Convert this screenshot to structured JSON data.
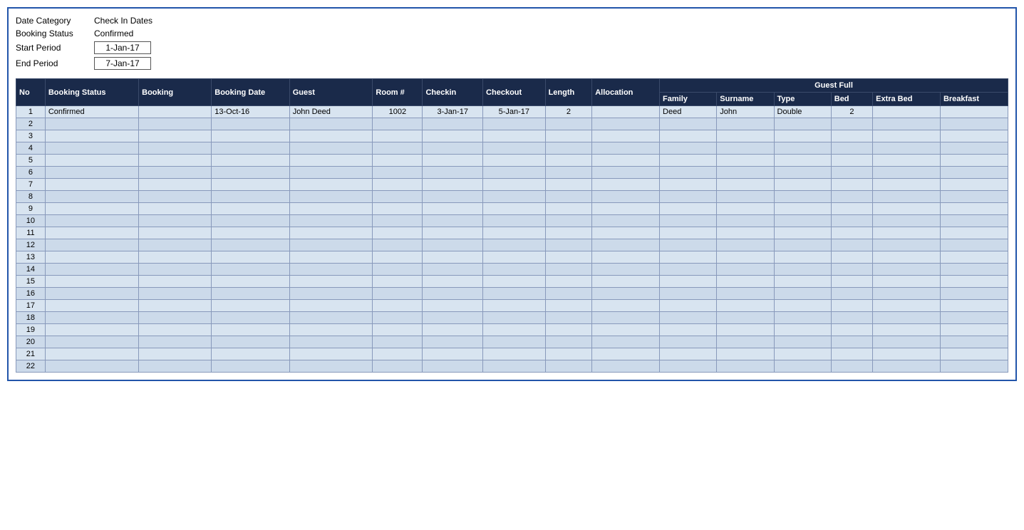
{
  "filters": {
    "date_category_label": "Date Category",
    "date_category_value": "Check In Dates",
    "booking_status_label": "Booking Status",
    "booking_status_value": "Confirmed",
    "start_period_label": "Start Period",
    "start_period_value": "1-Jan-17",
    "end_period_label": "End Period",
    "end_period_value": "7-Jan-17"
  },
  "table": {
    "headers": {
      "no": "No",
      "booking_status": "Booking Status",
      "booking": "Booking",
      "booking_date": "Booking Date",
      "guest": "Guest",
      "room": "Room #",
      "checkin": "Checkin",
      "checkout": "Checkout",
      "length": "Length",
      "allocation": "Allocation",
      "guest_full": "Guest Full",
      "family": "Family",
      "surname": "Surname",
      "type": "Type",
      "bed": "Bed",
      "extra_bed": "Extra Bed",
      "breakfast": "Breakfast"
    },
    "rows": [
      {
        "no": 1,
        "booking_status": "Confirmed",
        "booking": "",
        "booking_date": "13-Oct-16",
        "guest": "John Deed",
        "room": "1002",
        "checkin": "3-Jan-17",
        "checkout": "5-Jan-17",
        "length": "2",
        "allocation": "",
        "family": "Deed",
        "surname": "John",
        "type": "Double",
        "bed": "2",
        "extra_bed": "",
        "breakfast": ""
      },
      {
        "no": 2,
        "booking_status": "",
        "booking": "",
        "booking_date": "",
        "guest": "",
        "room": "",
        "checkin": "",
        "checkout": "",
        "length": "",
        "allocation": "",
        "family": "",
        "surname": "",
        "type": "",
        "bed": "",
        "extra_bed": "",
        "breakfast": ""
      },
      {
        "no": 3,
        "booking_status": "",
        "booking": "",
        "booking_date": "",
        "guest": "",
        "room": "",
        "checkin": "",
        "checkout": "",
        "length": "",
        "allocation": "",
        "family": "",
        "surname": "",
        "type": "",
        "bed": "",
        "extra_bed": "",
        "breakfast": ""
      },
      {
        "no": 4,
        "booking_status": "",
        "booking": "",
        "booking_date": "",
        "guest": "",
        "room": "",
        "checkin": "",
        "checkout": "",
        "length": "",
        "allocation": "",
        "family": "",
        "surname": "",
        "type": "",
        "bed": "",
        "extra_bed": "",
        "breakfast": ""
      },
      {
        "no": 5,
        "booking_status": "",
        "booking": "",
        "booking_date": "",
        "guest": "",
        "room": "",
        "checkin": "",
        "checkout": "",
        "length": "",
        "allocation": "",
        "family": "",
        "surname": "",
        "type": "",
        "bed": "",
        "extra_bed": "",
        "breakfast": ""
      },
      {
        "no": 6,
        "booking_status": "",
        "booking": "",
        "booking_date": "",
        "guest": "",
        "room": "",
        "checkin": "",
        "checkout": "",
        "length": "",
        "allocation": "",
        "family": "",
        "surname": "",
        "type": "",
        "bed": "",
        "extra_bed": "",
        "breakfast": ""
      },
      {
        "no": 7,
        "booking_status": "",
        "booking": "",
        "booking_date": "",
        "guest": "",
        "room": "",
        "checkin": "",
        "checkout": "",
        "length": "",
        "allocation": "",
        "family": "",
        "surname": "",
        "type": "",
        "bed": "",
        "extra_bed": "",
        "breakfast": ""
      },
      {
        "no": 8,
        "booking_status": "",
        "booking": "",
        "booking_date": "",
        "guest": "",
        "room": "",
        "checkin": "",
        "checkout": "",
        "length": "",
        "allocation": "",
        "family": "",
        "surname": "",
        "type": "",
        "bed": "",
        "extra_bed": "",
        "breakfast": ""
      },
      {
        "no": 9,
        "booking_status": "",
        "booking": "",
        "booking_date": "",
        "guest": "",
        "room": "",
        "checkin": "",
        "checkout": "",
        "length": "",
        "allocation": "",
        "family": "",
        "surname": "",
        "type": "",
        "bed": "",
        "extra_bed": "",
        "breakfast": ""
      },
      {
        "no": 10,
        "booking_status": "",
        "booking": "",
        "booking_date": "",
        "guest": "",
        "room": "",
        "checkin": "",
        "checkout": "",
        "length": "",
        "allocation": "",
        "family": "",
        "surname": "",
        "type": "",
        "bed": "",
        "extra_bed": "",
        "breakfast": ""
      },
      {
        "no": 11,
        "booking_status": "",
        "booking": "",
        "booking_date": "",
        "guest": "",
        "room": "",
        "checkin": "",
        "checkout": "",
        "length": "",
        "allocation": "",
        "family": "",
        "surname": "",
        "type": "",
        "bed": "",
        "extra_bed": "",
        "breakfast": ""
      },
      {
        "no": 12,
        "booking_status": "",
        "booking": "",
        "booking_date": "",
        "guest": "",
        "room": "",
        "checkin": "",
        "checkout": "",
        "length": "",
        "allocation": "",
        "family": "",
        "surname": "",
        "type": "",
        "bed": "",
        "extra_bed": "",
        "breakfast": ""
      },
      {
        "no": 13,
        "booking_status": "",
        "booking": "",
        "booking_date": "",
        "guest": "",
        "room": "",
        "checkin": "",
        "checkout": "",
        "length": "",
        "allocation": "",
        "family": "",
        "surname": "",
        "type": "",
        "bed": "",
        "extra_bed": "",
        "breakfast": ""
      },
      {
        "no": 14,
        "booking_status": "",
        "booking": "",
        "booking_date": "",
        "guest": "",
        "room": "",
        "checkin": "",
        "checkout": "",
        "length": "",
        "allocation": "",
        "family": "",
        "surname": "",
        "type": "",
        "bed": "",
        "extra_bed": "",
        "breakfast": ""
      },
      {
        "no": 15,
        "booking_status": "",
        "booking": "",
        "booking_date": "",
        "guest": "",
        "room": "",
        "checkin": "",
        "checkout": "",
        "length": "",
        "allocation": "",
        "family": "",
        "surname": "",
        "type": "",
        "bed": "",
        "extra_bed": "",
        "breakfast": ""
      },
      {
        "no": 16,
        "booking_status": "",
        "booking": "",
        "booking_date": "",
        "guest": "",
        "room": "",
        "checkin": "",
        "checkout": "",
        "length": "",
        "allocation": "",
        "family": "",
        "surname": "",
        "type": "",
        "bed": "",
        "extra_bed": "",
        "breakfast": ""
      },
      {
        "no": 17,
        "booking_status": "",
        "booking": "",
        "booking_date": "",
        "guest": "",
        "room": "",
        "checkin": "",
        "checkout": "",
        "length": "",
        "allocation": "",
        "family": "",
        "surname": "",
        "type": "",
        "bed": "",
        "extra_bed": "",
        "breakfast": ""
      },
      {
        "no": 18,
        "booking_status": "",
        "booking": "",
        "booking_date": "",
        "guest": "",
        "room": "",
        "checkin": "",
        "checkout": "",
        "length": "",
        "allocation": "",
        "family": "",
        "surname": "",
        "type": "",
        "bed": "",
        "extra_bed": "",
        "breakfast": ""
      },
      {
        "no": 19,
        "booking_status": "",
        "booking": "",
        "booking_date": "",
        "guest": "",
        "room": "",
        "checkin": "",
        "checkout": "",
        "length": "",
        "allocation": "",
        "family": "",
        "surname": "",
        "type": "",
        "bed": "",
        "extra_bed": "",
        "breakfast": ""
      },
      {
        "no": 20,
        "booking_status": "",
        "booking": "",
        "booking_date": "",
        "guest": "",
        "room": "",
        "checkin": "",
        "checkout": "",
        "length": "",
        "allocation": "",
        "family": "",
        "surname": "",
        "type": "",
        "bed": "",
        "extra_bed": "",
        "breakfast": ""
      },
      {
        "no": 21,
        "booking_status": "",
        "booking": "",
        "booking_date": "",
        "guest": "",
        "room": "",
        "checkin": "",
        "checkout": "",
        "length": "",
        "allocation": "",
        "family": "",
        "surname": "",
        "type": "",
        "bed": "",
        "extra_bed": "",
        "breakfast": ""
      },
      {
        "no": 22,
        "booking_status": "",
        "booking": "",
        "booking_date": "",
        "guest": "",
        "room": "",
        "checkin": "",
        "checkout": "",
        "length": "",
        "allocation": "",
        "family": "",
        "surname": "",
        "type": "",
        "bed": "",
        "extra_bed": "",
        "breakfast": ""
      }
    ]
  }
}
